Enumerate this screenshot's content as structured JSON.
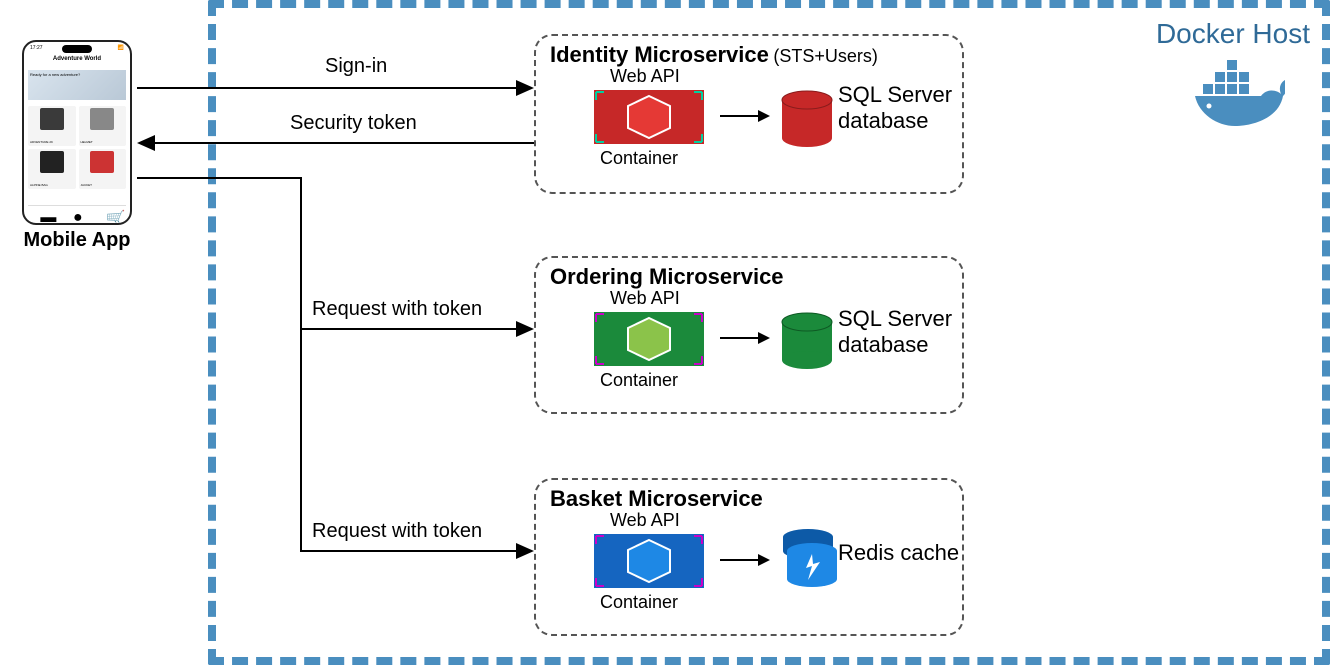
{
  "dockerHost": {
    "label": "Docker Host"
  },
  "mobileApp": {
    "label": "Mobile App",
    "statusTime": "17:27",
    "headerTitle": "Adventure World",
    "heroTitle": "Ready for a new adventure?",
    "navIcons": [
      "home-icon",
      "user-icon",
      "cart-icon"
    ]
  },
  "edges": {
    "signIn": "Sign-in",
    "securityToken": "Security token",
    "requestWithToken1": "Request with token",
    "requestWithToken2": "Request with token"
  },
  "microservices": {
    "identity": {
      "title": "Identity Microservice",
      "subtitle": "(STS+Users)",
      "webApiLabel": "Web API",
      "containerLabel": "Container",
      "storageLabel": "SQL Server database",
      "color": "#C62828",
      "hexFill": "#E53935"
    },
    "ordering": {
      "title": "Ordering Microservice",
      "subtitle": "",
      "webApiLabel": "Web API",
      "containerLabel": "Container",
      "storageLabel": "SQL Server database",
      "color": "#1B8A3B",
      "hexFill": "#7CB342"
    },
    "basket": {
      "title": "Basket Microservice",
      "subtitle": "",
      "webApiLabel": "Web API",
      "containerLabel": "Container",
      "storageLabel": "Redis cache",
      "color": "#1565C0",
      "hexFill": "#1E88E5"
    }
  }
}
